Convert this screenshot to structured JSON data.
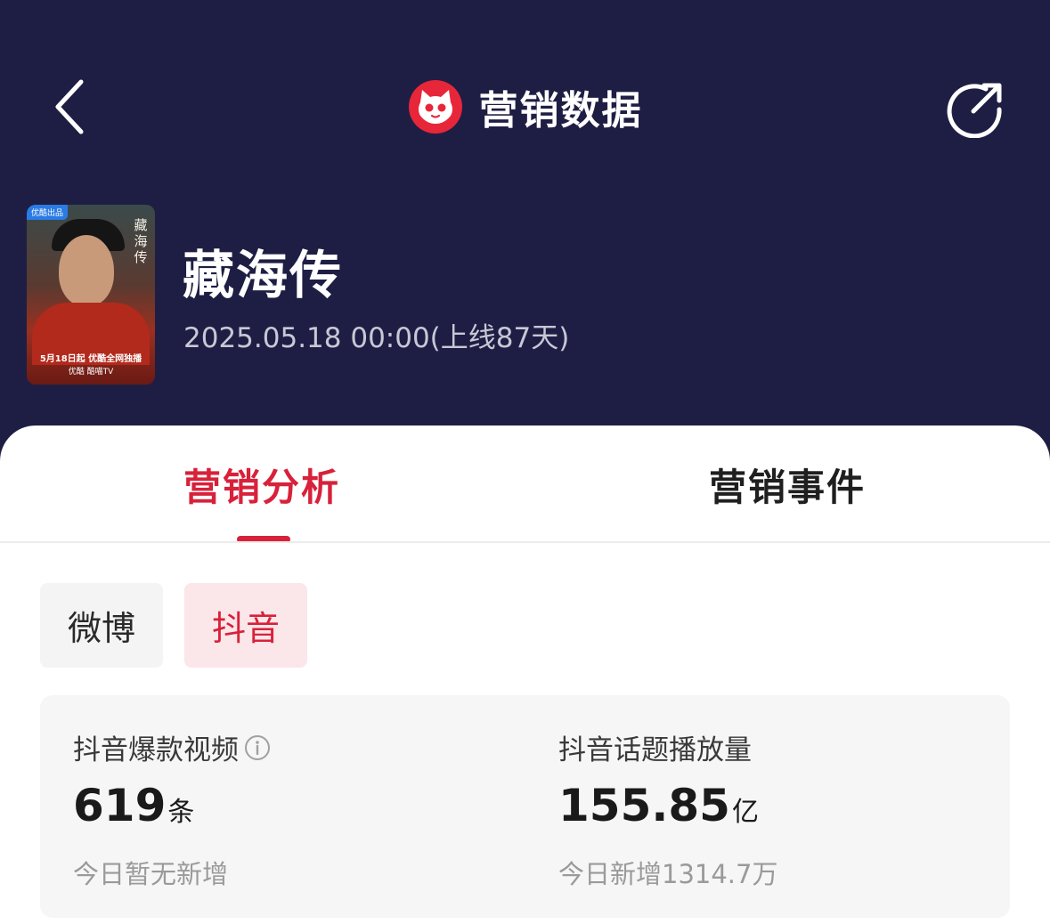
{
  "nav": {
    "title": "营销数据",
    "back_icon": "back-chevron-icon",
    "share_icon": "share-icon",
    "logo_icon": "cat-logo-icon",
    "logo_color": "#e8263a"
  },
  "drama": {
    "title": "藏海传",
    "release": "2025.05.18 00:00(上线87天)",
    "poster": {
      "tag": "优酷出品",
      "title_vertical": "藏海传",
      "line1": "5月18日起 优酷全网独播",
      "line2": "优酷 酷喵TV"
    }
  },
  "tabs": [
    {
      "label": "营销分析",
      "active": true
    },
    {
      "label": "营销事件",
      "active": false
    }
  ],
  "platforms": [
    {
      "label": "微博",
      "active": false
    },
    {
      "label": "抖音",
      "active": true
    }
  ],
  "stats": [
    {
      "label": "抖音爆款视频",
      "value": "619",
      "unit": "条",
      "sub": "今日暂无新增",
      "info_icon": "info-icon"
    },
    {
      "label": "抖音话题播放量",
      "value": "155.85",
      "unit": "亿",
      "sub": "今日新增1314.7万"
    }
  ],
  "colors": {
    "header_bg": "#1e1e44",
    "accent": "#d8213a",
    "chip_active_bg": "#fbe6e9",
    "card_bg": "#f6f6f6"
  }
}
